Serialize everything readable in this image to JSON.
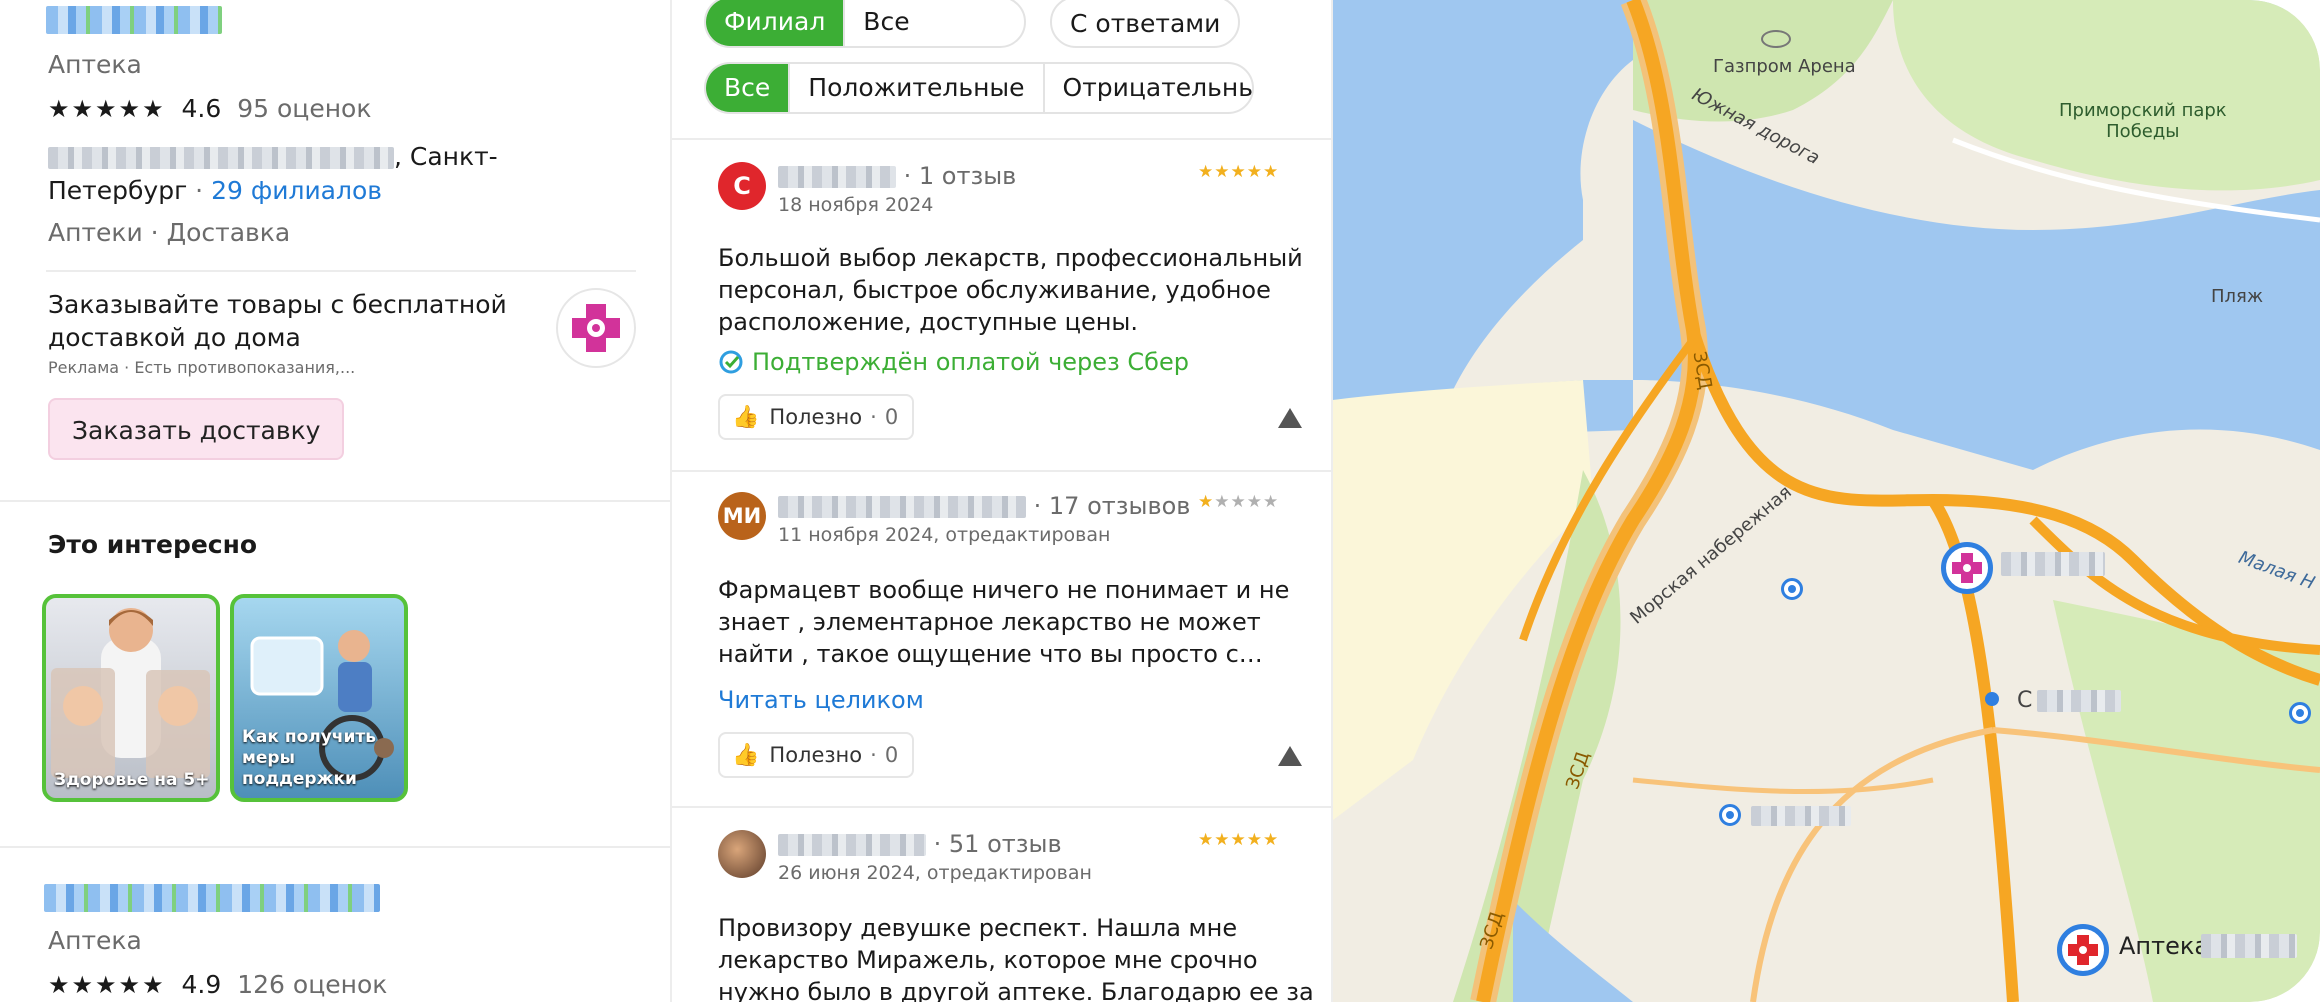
{
  "left_panel": {
    "place1": {
      "category": "Аптека",
      "stars": "★★★★★",
      "rating": "4.6",
      "ratings_count": "95 оценок",
      "address_city": ", Санкт-",
      "address_city2": "Петербург",
      "branches_link": "29 филиалов",
      "tags": "Аптеки · Доставка"
    },
    "ad": {
      "text_line1": "Заказывайте товары с бесплатной",
      "text_line2": "доставкой до дома",
      "disclaimer": "Реклама · Есть противопоказания,...",
      "button_label": "Заказать доставку"
    },
    "interesting": {
      "title": "Это интересно",
      "cards": [
        {
          "label": "Здоровье на 5+"
        },
        {
          "label": "Как получить меры поддержки",
          "label_lines": [
            "Как получить",
            "меры",
            "поддержки"
          ]
        }
      ]
    },
    "place2": {
      "category": "Аптека",
      "stars": "★★★★★",
      "rating": "4.9",
      "ratings_count": "126 оценок"
    }
  },
  "reviews_panel": {
    "filter_tabs": [
      {
        "label": "Филиал",
        "active": true
      },
      {
        "label": "Все филиалы",
        "active": false
      }
    ],
    "with_replies_chip": "С ответами",
    "sentiment_tabs": [
      {
        "label": "Все",
        "active": true
      },
      {
        "label": "Положительные",
        "active": false
      },
      {
        "label": "Отрицательные",
        "active": false
      }
    ],
    "reviews": [
      {
        "avatar_text": "С",
        "avatar_color": "#e0262c",
        "count": "· 1 отзыв",
        "date": "18 ноября 2024",
        "rating": 5,
        "stars": "★★★★★",
        "text_lines": [
          "Большой выбор лекарств, профессиональный",
          "персонал, быстрое обслуживание, удобное",
          "расположение, доступные цены."
        ],
        "verified": "Подтверждён оплатой через Сбер",
        "useful_label": "Полезно",
        "useful_count": "0"
      },
      {
        "avatar_text": "МИ",
        "avatar_color": "#b9631b",
        "count": "· 17 отзывов",
        "date": "11 ноября 2024, отредактирован",
        "rating": 1,
        "stars": "★★★★★",
        "text_lines": [
          "Фармацевт вообще ничего не понимает и не",
          "знает , элементарное лекарство не может",
          "найти , такое ощущение что вы просто с…"
        ],
        "read_more": "Читать целиком",
        "useful_label": "Полезно",
        "useful_count": "0"
      },
      {
        "avatar_text": "",
        "avatar_color": "#8a5a3c",
        "count": "· 51 отзыв",
        "date": "26 июня 2024, отредактирован",
        "rating": 5,
        "stars": "★★★★★",
        "text_lines": [
          "Провизору девушке респект. Нашла мне",
          "лекарство Миражель, которое мне срочно",
          "нужно было в другой аптеке. Благодарю ее за"
        ]
      }
    ]
  },
  "map": {
    "labels": {
      "gazprom": "Газпром Арена",
      "south_road": "Южная дорога",
      "park_line1": "Приморский парк",
      "park_line2": "Победы",
      "beach": "Пляж",
      "zsd1": "ЗСД",
      "zsd2": "ЗСД",
      "zsd3": "ЗСД",
      "embankment": "Морская набережная",
      "malaya": "Малая Н",
      "pharmacy": "Аптека",
      "c_label": "С"
    },
    "colors": {
      "water": "#9fc7f0",
      "land": "#f1ede3",
      "sand": "#fbf6d9",
      "park": "#cfe6b0",
      "highway": "#f6a623"
    }
  }
}
